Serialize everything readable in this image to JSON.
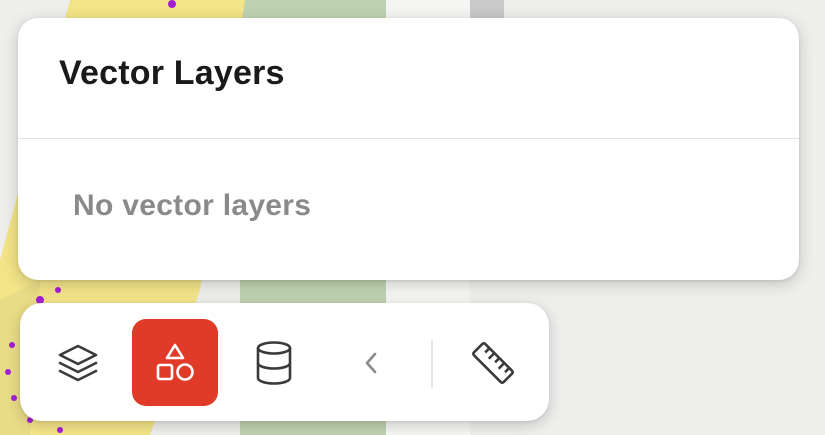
{
  "panel": {
    "title": "Vector Layers",
    "empty_message": "No vector layers"
  },
  "toolbar": {
    "items": [
      {
        "icon": "layers-icon",
        "active": false
      },
      {
        "icon": "shapes-icon",
        "active": true
      },
      {
        "icon": "database-icon",
        "active": false
      },
      {
        "icon": "chevron-left-icon",
        "active": false
      },
      {
        "icon": "ruler-icon",
        "active": false
      }
    ]
  },
  "colors": {
    "active_tool": "#e23a28",
    "map_yellow": "#f3e488",
    "map_green": "#bfd2b0",
    "map_marker": "#a21fd6"
  }
}
